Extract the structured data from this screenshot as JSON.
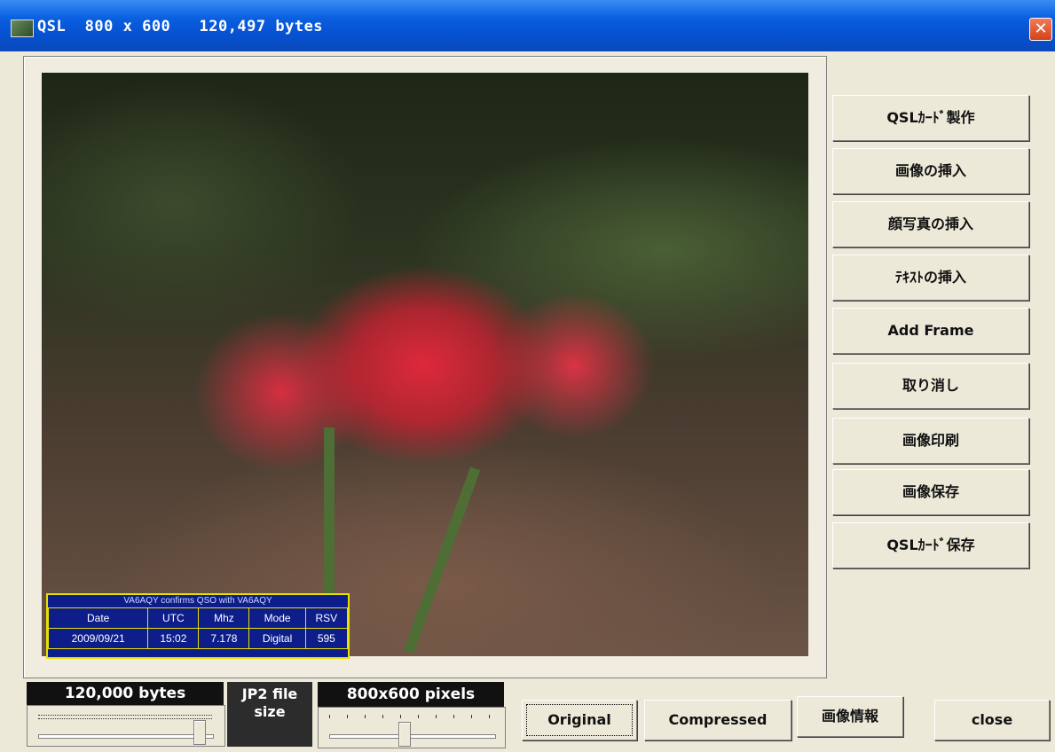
{
  "window": {
    "title": "QSL  800 x 600   120,497 bytes",
    "close_glyph": "✕"
  },
  "qso_table": {
    "header_text": "VA6AQY confirms QSO with VA6AQY",
    "columns": [
      "Date",
      "UTC",
      "Mhz",
      "Mode",
      "RSV"
    ],
    "row": [
      "2009/09/21",
      "15:02",
      "7.178",
      "Digital",
      "595"
    ]
  },
  "side_buttons": [
    {
      "label": "QSLｶｰﾄﾞ製作"
    },
    {
      "label": "画像の挿入"
    },
    {
      "label": "顔写真の挿入"
    },
    {
      "label": "ﾃｷｽﾄの挿入"
    },
    {
      "label": "Add Frame"
    },
    {
      "label": "取り消し"
    },
    {
      "label": "画像印刷"
    },
    {
      "label": "画像保存"
    },
    {
      "label": "QSLｶｰﾄﾞ保存"
    }
  ],
  "bottom": {
    "size_label": "120,000 bytes",
    "jp2_label_line1": "JP2 file",
    "jp2_label_line2": "size",
    "pixels_label": "800x600 pixels",
    "size_slider_value": 0.95,
    "pixels_slider_value": 0.45,
    "original_label": "Original",
    "compressed_label": "Compressed",
    "info_label": "画像情報",
    "close_label": "close"
  }
}
